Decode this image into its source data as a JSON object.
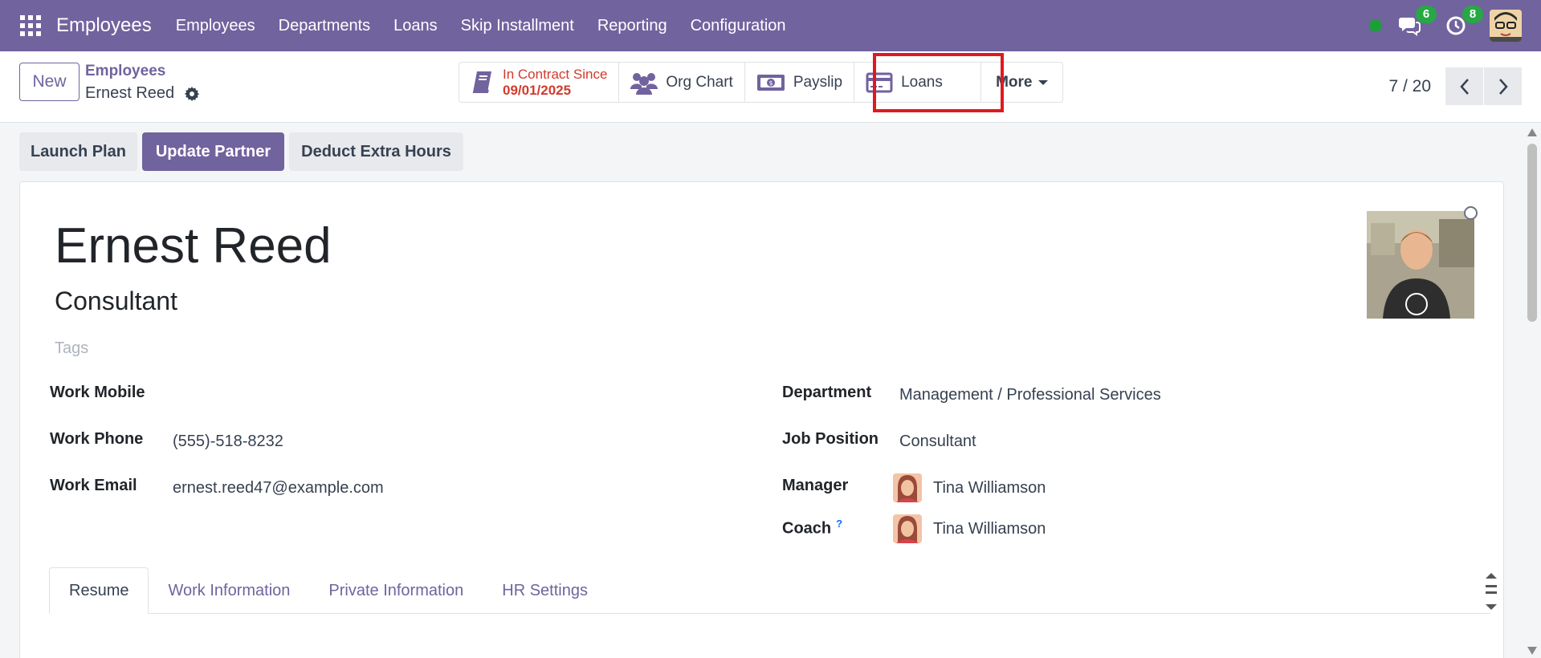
{
  "navbar": {
    "brand": "Employees",
    "menu": [
      "Employees",
      "Departments",
      "Loans",
      "Skip Installment",
      "Reporting",
      "Configuration"
    ],
    "messages_count": "6",
    "activities_count": "8",
    "accent_color": "#71639e"
  },
  "control_panel": {
    "new_label": "New",
    "breadcrumb_parent": "Employees",
    "breadcrumb_current": "Ernest Reed",
    "smart_buttons": {
      "contract_label": "In Contract Since",
      "contract_date": "09/01/2025",
      "org_chart": "Org Chart",
      "payslip": "Payslip",
      "loans": "Loans",
      "more": "More"
    },
    "pager": "7 / 20"
  },
  "actions": {
    "launch_plan": "Launch Plan",
    "update_partner": "Update Partner",
    "deduct_extra_hours": "Deduct Extra Hours"
  },
  "employee": {
    "name": "Ernest Reed",
    "job_title": "Consultant",
    "tags_placeholder": "Tags",
    "work_mobile_label": "Work Mobile",
    "work_mobile": "",
    "work_phone_label": "Work Phone",
    "work_phone": "(555)-518-8232",
    "work_email_label": "Work Email",
    "work_email": "ernest.reed47@example.com",
    "department_label": "Department",
    "department": "Management / Professional Services",
    "job_position_label": "Job Position",
    "job_position": "Consultant",
    "manager_label": "Manager",
    "manager": "Tina Williamson",
    "coach_label": "Coach",
    "coach_help": "?",
    "coach": "Tina Williamson"
  },
  "tabs": [
    "Resume",
    "Work Information",
    "Private Information",
    "HR Settings"
  ],
  "active_tab": "Resume"
}
